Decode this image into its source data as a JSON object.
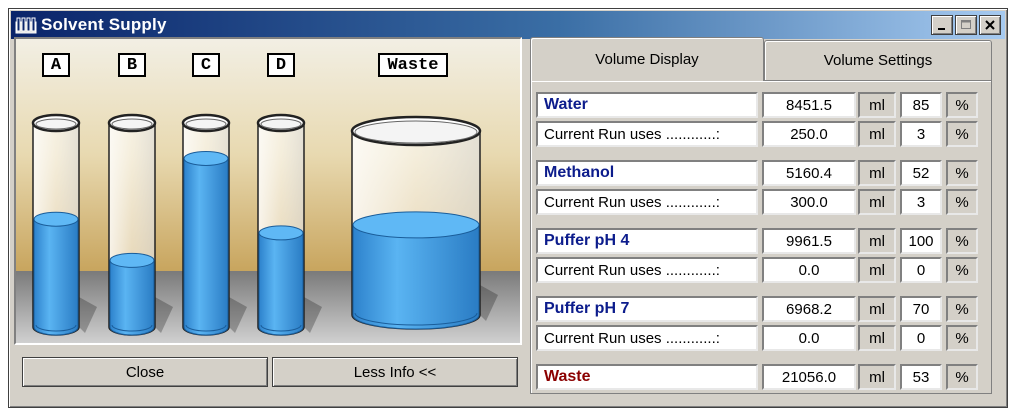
{
  "window": {
    "title": "Solvent Supply"
  },
  "titlebar_buttons": [
    "minimize-icon",
    "maximize-icon",
    "close-icon"
  ],
  "bottles": [
    {
      "label": "A",
      "fill_fraction": 0.55
    },
    {
      "label": "B",
      "fill_fraction": 0.34
    },
    {
      "label": "C",
      "fill_fraction": 0.86
    },
    {
      "label": "D",
      "fill_fraction": 0.48
    },
    {
      "label": "Waste",
      "fill_fraction": 0.53
    }
  ],
  "buttons": {
    "close": "Close",
    "less_info": "Less Info <<"
  },
  "tabs": [
    {
      "label": "Volume Display",
      "active": true
    },
    {
      "label": "Volume Settings",
      "active": false
    }
  ],
  "rows": [
    {
      "name": "Water",
      "volume": "8451.5",
      "unit": "ml",
      "percent": "85",
      "pct_sign": "%",
      "kind": "solvent"
    },
    {
      "name": "Current Run uses ............:",
      "volume": "250.0",
      "unit": "ml",
      "percent": "3",
      "pct_sign": "%",
      "kind": "run"
    },
    {
      "name": "Methanol",
      "volume": "5160.4",
      "unit": "ml",
      "percent": "52",
      "pct_sign": "%",
      "kind": "solvent"
    },
    {
      "name": "Current Run uses ............:",
      "volume": "300.0",
      "unit": "ml",
      "percent": "3",
      "pct_sign": "%",
      "kind": "run"
    },
    {
      "name": "Puffer pH 4",
      "volume": "9961.5",
      "unit": "ml",
      "percent": "100",
      "pct_sign": "%",
      "kind": "solvent"
    },
    {
      "name": "Current Run uses ............:",
      "volume": "0.0",
      "unit": "ml",
      "percent": "0",
      "pct_sign": "%",
      "kind": "run"
    },
    {
      "name": "Puffer pH 7",
      "volume": "6968.2",
      "unit": "ml",
      "percent": "70",
      "pct_sign": "%",
      "kind": "solvent"
    },
    {
      "name": "Current Run uses ............:",
      "volume": "0.0",
      "unit": "ml",
      "percent": "0",
      "pct_sign": "%",
      "kind": "run"
    },
    {
      "name": "Waste",
      "volume": "21056.0",
      "unit": "ml",
      "percent": "53",
      "pct_sign": "%",
      "kind": "waste"
    }
  ],
  "colors": {
    "liquid": "#4aa3e8",
    "liquid_dark": "#1d6fb5",
    "wall_top": "#d8c290",
    "floor": "#9a9a9a",
    "solvent_text": "#0c1c8c",
    "waste_text": "#8b0000"
  }
}
